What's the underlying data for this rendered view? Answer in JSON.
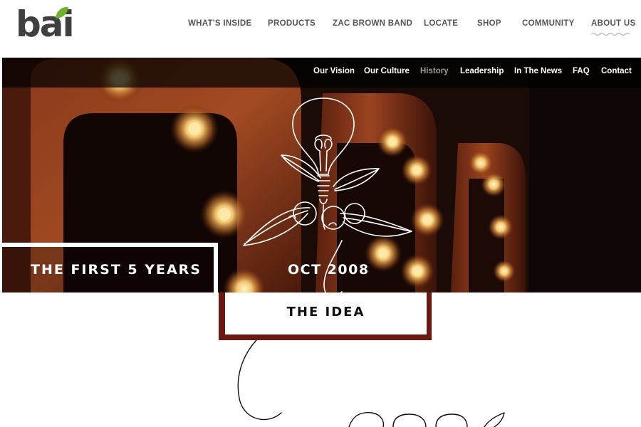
{
  "brand": {
    "logo_text": "bai",
    "leaf_color": "#6fb32c"
  },
  "main_nav": {
    "items": [
      {
        "label": "WHAT'S INSIDE"
      },
      {
        "label": "PRODUCTS"
      },
      {
        "label": "ZAC BROWN BAND"
      },
      {
        "label": "LOCATE"
      },
      {
        "label": "SHOP"
      },
      {
        "label": "COMMUNITY"
      },
      {
        "label": "ABOUT US"
      }
    ],
    "active": "ABOUT US"
  },
  "sub_nav": {
    "items": [
      {
        "label": "Our Vision"
      },
      {
        "label": "Our Culture"
      },
      {
        "label": "History"
      },
      {
        "label": "Leadership"
      },
      {
        "label": "In The News"
      },
      {
        "label": "FAQ"
      },
      {
        "label": "Contact"
      }
    ],
    "active": "History"
  },
  "hero": {
    "heading": "THE FIRST 5 YEARS",
    "date": "OCT 2008",
    "milestone_title": "THE IDEA"
  },
  "colors": {
    "accent_frame": "#6a1a10",
    "nav_text": "#555555",
    "subnav_active": "#9a9a9a"
  }
}
